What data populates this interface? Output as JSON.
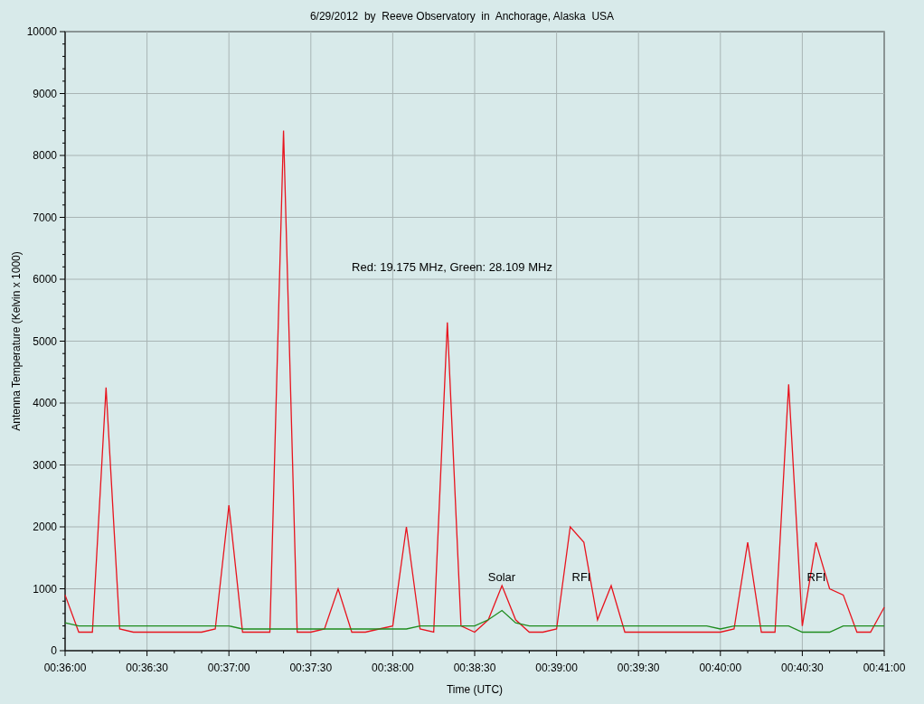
{
  "chart": {
    "chart_data": {
      "type": "line",
      "title": "6/29/2012  by  Reeve Observatory  in  Anchorage, Alaska  USA",
      "xlabel": "Time (UTC)",
      "ylabel": "Antenna Temperature (Kelvin x 1000)",
      "categories": [
        "00:36:00",
        null,
        null,
        null,
        null,
        null,
        "00:36:30",
        null,
        null,
        null,
        null,
        null,
        "00:37:00",
        null,
        null,
        null,
        null,
        null,
        "00:37:30",
        null,
        null,
        null,
        null,
        null,
        "00:38:00",
        null,
        null,
        null,
        null,
        null,
        "00:38:30",
        null,
        null,
        null,
        null,
        null,
        "00:39:00",
        null,
        null,
        null,
        null,
        null,
        "00:39:30",
        null,
        null,
        null,
        null,
        null,
        "00:40:00",
        null,
        null,
        null,
        null,
        null,
        "00:40:30",
        null,
        null,
        null,
        null,
        null,
        "00:41:00"
      ],
      "series": [
        {
          "color": "#e8141e",
          "values": [
            900,
            300,
            300,
            4250,
            350,
            300,
            300,
            300,
            300,
            300,
            300,
            350,
            2350,
            300,
            300,
            300,
            8400,
            300,
            300,
            350,
            1000,
            300,
            300,
            350,
            400,
            2000,
            350,
            300,
            5300,
            400,
            300,
            500,
            1050,
            500,
            300,
            300,
            350,
            2000,
            1750,
            500,
            1050,
            300,
            300,
            300,
            300,
            300,
            300,
            300,
            300,
            350,
            1750,
            300,
            300,
            4300,
            400,
            1750,
            1000,
            900,
            300,
            300,
            700
          ]
        },
        {
          "color": "#1e8c1e",
          "values": [
            450,
            400,
            400,
            400,
            400,
            400,
            400,
            400,
            400,
            400,
            400,
            400,
            400,
            350,
            350,
            350,
            350,
            350,
            350,
            350,
            350,
            350,
            350,
            350,
            350,
            350,
            400,
            400,
            400,
            400,
            400,
            500,
            650,
            450,
            400,
            400,
            400,
            400,
            400,
            400,
            400,
            400,
            400,
            400,
            400,
            400,
            400,
            400,
            350,
            400,
            400,
            400,
            400,
            400,
            300,
            300,
            300,
            400,
            400,
            400,
            400
          ]
        }
      ],
      "grid": true,
      "ylim": [
        0,
        10000
      ],
      "yticks": [
        0,
        1000,
        2000,
        3000,
        4000,
        5000,
        6000,
        7000,
        8000,
        9000,
        10000
      ],
      "annotations": [
        "Red: 19.175 MHz, Green: 28.109 MHz",
        "Solar",
        "RFI",
        "RFI"
      ]
    }
  }
}
